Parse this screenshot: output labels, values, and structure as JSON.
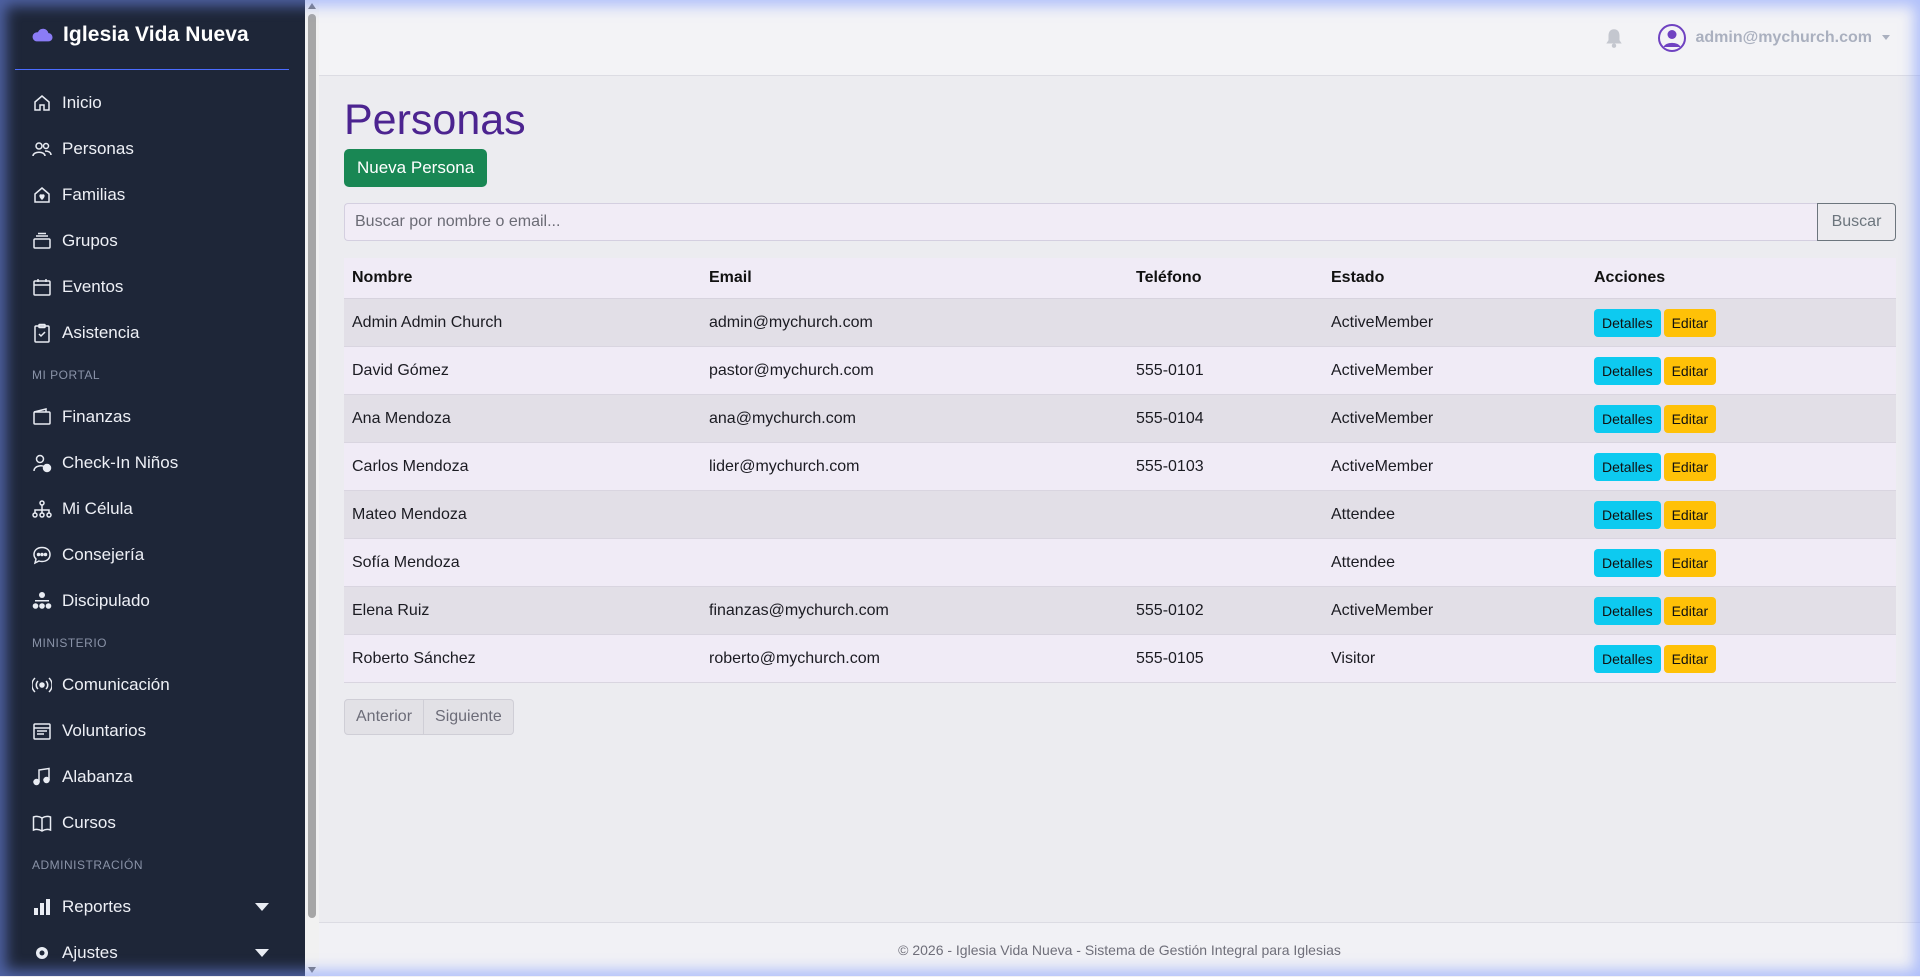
{
  "brand": {
    "name": "Iglesia Vida Nueva"
  },
  "sidebar": {
    "main": [
      {
        "label": "Inicio",
        "icon": "home-icon"
      },
      {
        "label": "Personas",
        "icon": "people-icon"
      },
      {
        "label": "Familias",
        "icon": "house-heart-icon"
      },
      {
        "label": "Grupos",
        "icon": "collection-icon"
      },
      {
        "label": "Eventos",
        "icon": "calendar-icon"
      },
      {
        "label": "Asistencia",
        "icon": "clipboard-check-icon"
      }
    ],
    "section_portal": "MI PORTAL",
    "portal": [
      {
        "label": "Finanzas",
        "icon": "wallet-icon"
      },
      {
        "label": "Check-In Niños",
        "icon": "person-check-icon"
      },
      {
        "label": "Mi Célula",
        "icon": "diagram-icon"
      },
      {
        "label": "Consejería",
        "icon": "chat-dots-icon"
      },
      {
        "label": "Discipulado",
        "icon": "hierarchy-icon"
      }
    ],
    "section_ministerio": "MINISTERIO",
    "ministerio": [
      {
        "label": "Comunicación",
        "icon": "broadcast-icon"
      },
      {
        "label": "Voluntarios",
        "icon": "calendar-week-icon"
      },
      {
        "label": "Alabanza",
        "icon": "music-note-icon"
      },
      {
        "label": "Cursos",
        "icon": "book-icon"
      }
    ],
    "section_admin": "ADMINISTRACIÓN",
    "admin": [
      {
        "label": "Reportes",
        "icon": "bar-chart-icon"
      },
      {
        "label": "Ajustes",
        "icon": "gear-icon"
      }
    ]
  },
  "topbar": {
    "user_email": "admin@mychurch.com"
  },
  "page": {
    "title": "Personas",
    "new_button": "Nueva Persona",
    "search_placeholder": "Buscar por nombre o email...",
    "search_button": "Buscar"
  },
  "table": {
    "headers": [
      "Nombre",
      "Email",
      "Teléfono",
      "Estado",
      "Acciones"
    ],
    "details_label": "Detalles",
    "edit_label": "Editar",
    "rows": [
      {
        "name": "Admin Admin Church",
        "email": "admin@mychurch.com",
        "phone": "",
        "status": "ActiveMember"
      },
      {
        "name": "David Gómez",
        "email": "pastor@mychurch.com",
        "phone": "555-0101",
        "status": "ActiveMember"
      },
      {
        "name": "Ana Mendoza",
        "email": "ana@mychurch.com",
        "phone": "555-0104",
        "status": "ActiveMember"
      },
      {
        "name": "Carlos Mendoza",
        "email": "lider@mychurch.com",
        "phone": "555-0103",
        "status": "ActiveMember"
      },
      {
        "name": "Mateo Mendoza",
        "email": "",
        "phone": "",
        "status": "Attendee"
      },
      {
        "name": "Sofía Mendoza",
        "email": "",
        "phone": "",
        "status": "Attendee"
      },
      {
        "name": "Elena Ruiz",
        "email": "finanzas@mychurch.com",
        "phone": "555-0102",
        "status": "ActiveMember"
      },
      {
        "name": "Roberto Sánchez",
        "email": "roberto@mychurch.com",
        "phone": "555-0105",
        "status": "Visitor"
      }
    ]
  },
  "pager": {
    "prev": "Anterior",
    "next": "Siguiente"
  },
  "footer": {
    "text": "© 2026 - Iglesia Vida Nueva - Sistema de Gestión Integral para Iglesias"
  },
  "colors": {
    "sidebar": "#1e2638",
    "title": "#4c2490",
    "primary_green": "#198754",
    "info": "#0dcaf0",
    "warning": "#ffc107"
  }
}
